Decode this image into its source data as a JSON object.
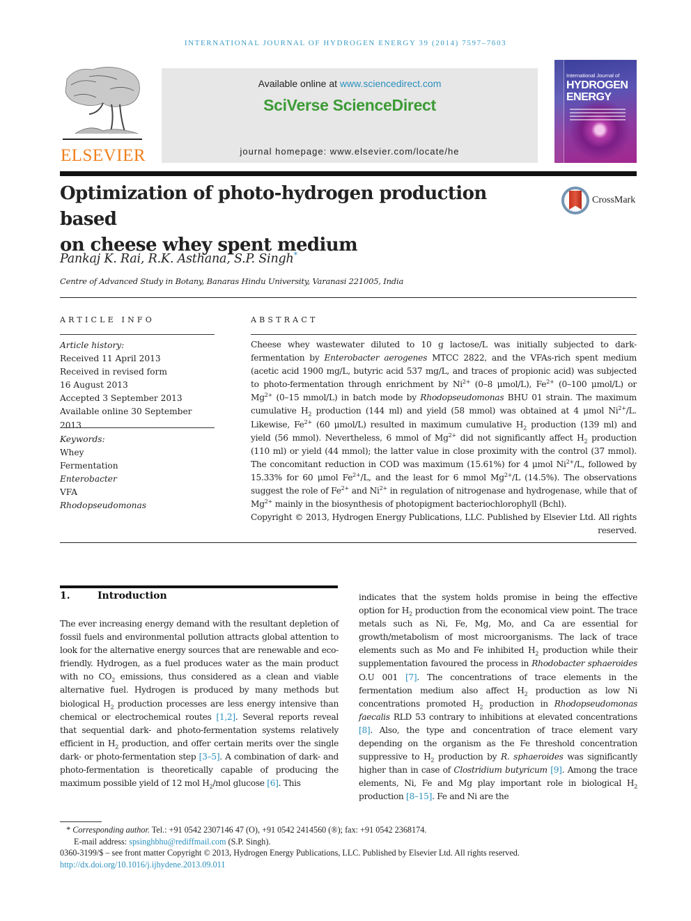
{
  "running_head": "INTERNATIONAL JOURNAL OF HYDROGEN ENERGY 39 (2014) 7597–7603",
  "masthead": {
    "publisher": "ELSEVIER",
    "available_prefix": "Available online at ",
    "available_link": "www.sciencedirect.com",
    "brand": "SciVerse ScienceDirect",
    "homepage": "journal homepage: www.elsevier.com/locate/he",
    "cover": {
      "small_title": "International Journal of",
      "big_title_1": "HYDROGEN",
      "big_title_2": "ENERGY"
    }
  },
  "article": {
    "title_line_1": "Optimization of photo-hydrogen production based",
    "title_line_2": "on cheese whey spent medium",
    "crossmark_label": "CrossMark",
    "authors": "Pankaj K. Rai, R.K. Asthana, S.P. Singh",
    "corresponding_marker": "*",
    "affiliation": "Centre of Advanced Study in Botany, Banaras Hindu University, Varanasi 221005, India"
  },
  "article_info": {
    "label": "ARTICLE INFO",
    "history_label": "Article history:",
    "history": [
      "Received 11 April 2013",
      "Received in revised form",
      "16 August 2013",
      "Accepted 3 September 2013",
      "Available online 30 September 2013"
    ],
    "keywords_label": "Keywords:",
    "keywords": [
      {
        "text": "Whey",
        "italic": false
      },
      {
        "text": "Fermentation",
        "italic": false
      },
      {
        "text": "Enterobacter",
        "italic": true
      },
      {
        "text": "VFA",
        "italic": false
      },
      {
        "text": "Rhodopseudomonas",
        "italic": true
      }
    ]
  },
  "abstract": {
    "label": "ABSTRACT",
    "segments": {
      "s1": "Cheese whey wastewater diluted to 10 g lactose/L was initially subjected to dark-fermentation by ",
      "i1": "Enterobacter aerogenes",
      "s2": " MTCC 2822, and the VFAs-rich spent medium (acetic acid 1900 mg/L, butyric acid 537 mg/L, and traces of propionic acid) was subjected to photo-fermentation through enrichment by Ni",
      "s3": " (0–8 μmol/L), Fe",
      "s4": " (0–100 μmol/L) or Mg",
      "s5": " (0–15 mmol/L) in batch mode by ",
      "i2": "Rhodopseudomonas",
      "s6": " BHU 01 strain. The maximum cumulative H",
      "s7": " production (144 ml) and yield (58 mmol) was obtained at 4 μmol Ni",
      "s8": "/L. Likewise, Fe",
      "s9": " (60 μmol/L) resulted in maximum cumulative H",
      "s10": " production (139 ml) and yield (56 mmol). Nevertheless, 6 mmol of Mg",
      "s11": " did not significantly affect H",
      "s12": " production (110 ml) or yield (44 mmol); the latter value in close proximity with the control (37 mmol). The concomitant reduction in COD was maximum (15.61%) for 4 μmol Ni",
      "s13": "/L, followed by 15.33% for 60 μmol Fe",
      "s14": "/L, and the least for 6 mmol Mg",
      "s15": "/L (14.5%). The observations suggest the role of Fe",
      "s16": " and Ni",
      "s17": " in regulation of nitrogenase and hydrogenase, while that of Mg",
      "s18": " mainly in the biosynthesis of photopigment bacteriochlorophyll (Bchl).",
      "charge": "2+",
      "sub2": "2"
    },
    "copyright_1": "Copyright © 2013, Hydrogen Energy Publications, LLC. Published by Elsevier Ltd. All rights",
    "copyright_2": "reserved."
  },
  "introduction": {
    "number": "1.",
    "heading": "Introduction",
    "left": {
      "p1": "The ever increasing energy demand with the resultant depletion of fossil fuels and environmental pollution attracts global attention to look for the alternative energy sources that are renewable and eco-friendly. Hydrogen, as a fuel produces water as the main product with no CO",
      "p2": " emissions, thus considered as a clean and viable alternative fuel. Hydrogen is produced by many methods but biological H",
      "p3": " production processes are less energy intensive than chemical or electrochemical routes ",
      "r1": "[1,2]",
      "p4": ". Several reports reveal that sequential dark- and photo-fermentation systems relatively efficient in H",
      "p5": " production, and offer certain merits over the single dark- or photo-fermentation step ",
      "r2": "[3–5]",
      "p6": ". A combination of dark- and photo-fermentation is theoretically capable of producing the maximum possible yield of 12 mol H",
      "p7": "/mol glucose ",
      "r3": "[6]",
      "p8": ". This"
    },
    "right": {
      "p1": "indicates that the system holds promise in being the effective option for H",
      "p2": " production from the economical view point. The trace metals such as Ni, Fe, Mg, Mo, and Ca are essential for growth/metabolism of most microorganisms. The lack of trace elements such as Mo and Fe inhibited H",
      "p3": " production while their supplementation favoured the process in ",
      "i1": "Rhodobacter sphaeroides",
      "p4": " O.U 001 ",
      "r1": "[7]",
      "p5": ". The concentrations of trace elements in the fermentation medium also affect H",
      "p6": " production as low Ni concentrations promoted H",
      "p7": " production in ",
      "i2": "Rhodopseudomonas faecalis",
      "p8": " RLD 53 contrary to inhibitions at elevated concentrations ",
      "r2": "[8]",
      "p9": ". Also, the type and concentration of trace element vary depending on the organism as the Fe threshold concentration suppressive to H",
      "p10": " production by ",
      "i3": "R. sphaeroides",
      "p11": " was significantly higher than in case of ",
      "i4": "Clostridium butyricum",
      "p12": " ",
      "r3": "[9]",
      "p13": ". Among the trace elements, Ni, Fe and Mg play important role in biological H",
      "p14": " production ",
      "r4": "[8–15]",
      "p15": ". Fe and Ni are the"
    }
  },
  "footnotes": {
    "marker": "*",
    "corr_label": "Corresponding author.",
    "corr_contact": " Tel.: +91 0542 2307146 47 (O), +91 0542 2414560 (®); fax: +91 0542 2368174.",
    "email_label": "E-mail address: ",
    "email": "spsinghbhu@rediffmail.com",
    "email_suffix": " (S.P. Singh).",
    "issn_line": "0360-3199/$ – see front matter Copyright © 2013, Hydrogen Energy Publications, LLC. Published by Elsevier Ltd. All rights reserved.",
    "doi": "http://dx.doi.org/10.1016/j.ijhydene.2013.09.011"
  }
}
